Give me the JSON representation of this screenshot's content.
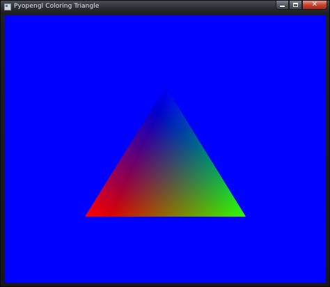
{
  "window": {
    "title": "Pyopengl Coloring Triangle",
    "icon": "window-app-icon",
    "controls": {
      "minimize": "minimize-icon",
      "maximize": "maximize-icon",
      "close": "close-icon"
    }
  },
  "scene": {
    "background_color": "#0000ff",
    "vertex_colors": {
      "top": "#0000ff",
      "bottom_left": "#ff0000",
      "bottom_right": "#00ff00"
    }
  }
}
